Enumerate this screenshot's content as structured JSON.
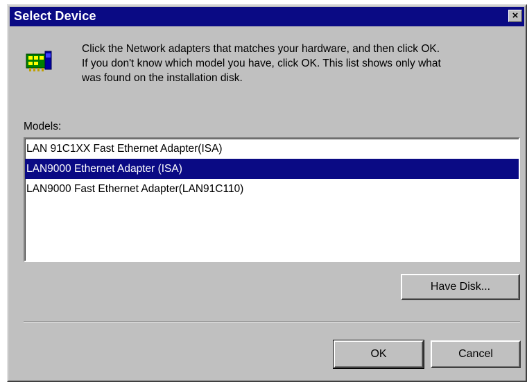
{
  "window": {
    "title": "Select Device",
    "close_glyph": "×"
  },
  "instructions": {
    "line1": "Click the Network adapters that matches your hardware, and then click OK.",
    "line2": "If you don't know which model you have, click OK. This list shows only what",
    "line3": "was found on the installation disk."
  },
  "icon": {
    "name": "network-adapter-icon"
  },
  "models": {
    "label": "Models:",
    "items": [
      "LAN 91C1XX Fast Ethernet Adapter(ISA)",
      "LAN9000 Ethernet Adapter (ISA)",
      "LAN9000 Fast Ethernet Adapter(LAN91C110)"
    ],
    "selected_index": 1
  },
  "buttons": {
    "have_disk": "Have Disk...",
    "ok": "OK",
    "cancel": "Cancel"
  },
  "colors": {
    "face": "#c0c0c0",
    "titlebar": "#0a0a84",
    "selection": "#0a0a84"
  }
}
